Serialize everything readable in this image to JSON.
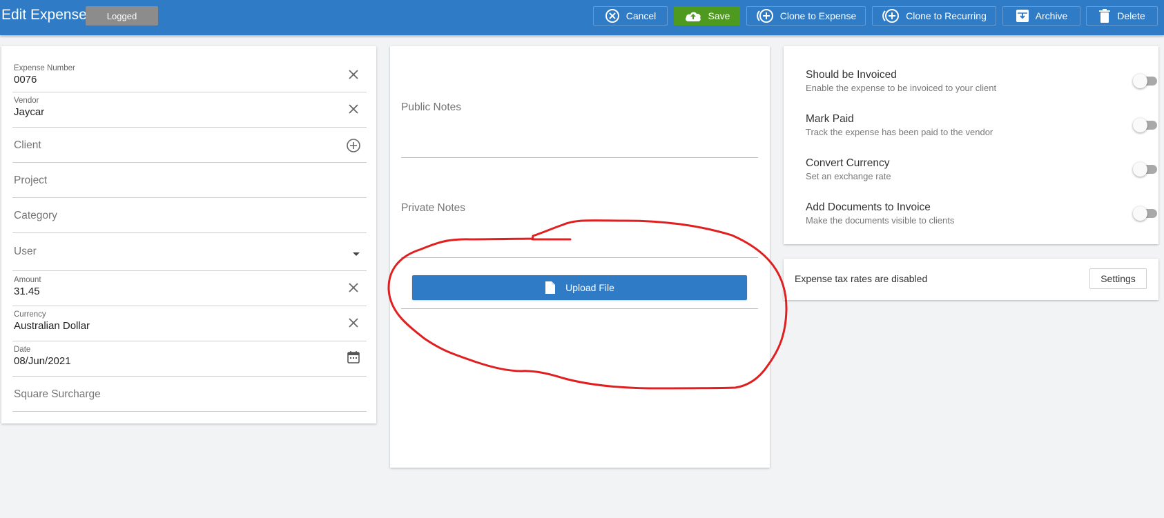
{
  "header": {
    "title": "Edit Expense",
    "status_badge": "Logged",
    "buttons": {
      "cancel": "Cancel",
      "save": "Save",
      "clone_expense": "Clone to Expense",
      "clone_recurring": "Clone to Recurring",
      "archive": "Archive",
      "delete": "Delete"
    }
  },
  "details": {
    "expense_number": {
      "label": "Expense Number",
      "value": "0076"
    },
    "vendor": {
      "label": "Vendor",
      "value": "Jaycar"
    },
    "client": {
      "label": "Client"
    },
    "project": {
      "label": "Project"
    },
    "category": {
      "label": "Category"
    },
    "user": {
      "label": "User"
    },
    "amount": {
      "label": "Amount",
      "value": "31.45"
    },
    "currency": {
      "label": "Currency",
      "value": "Australian Dollar"
    },
    "date": {
      "label": "Date",
      "value": "08/Jun/2021"
    },
    "surcharge": {
      "label": "Square Surcharge"
    }
  },
  "notes": {
    "public_label": "Public Notes",
    "private_label": "Private Notes",
    "upload_label": "Upload File"
  },
  "settings": {
    "toggles": [
      {
        "title": "Should be Invoiced",
        "subtitle": "Enable the expense to be invoiced to your client",
        "enabled": false
      },
      {
        "title": "Mark Paid",
        "subtitle": "Track the expense has been paid to the vendor",
        "enabled": false
      },
      {
        "title": "Convert Currency",
        "subtitle": "Set an exchange rate",
        "enabled": false
      },
      {
        "title": "Add Documents to Invoice",
        "subtitle": "Make the documents visible to clients",
        "enabled": false
      }
    ],
    "tax_message": "Expense tax rates are disabled",
    "settings_button": "Settings"
  },
  "colors": {
    "primary": "#2f7bc6",
    "save": "#4d9a1f",
    "annotation": "#e02020"
  }
}
